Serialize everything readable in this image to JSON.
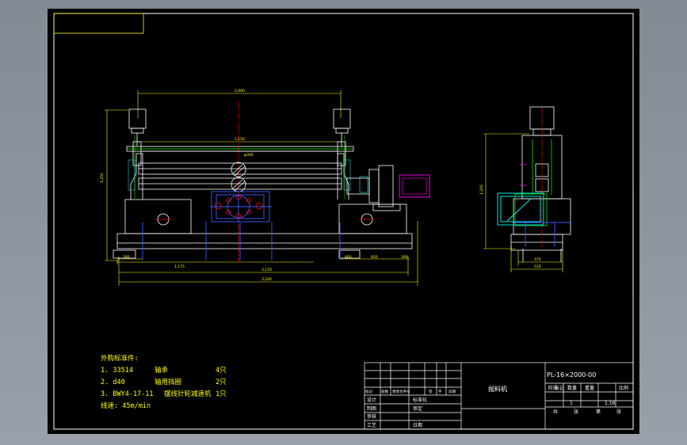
{
  "drawing": {
    "code": "PL-16×2000-00",
    "name": "抛料机",
    "scale": "1:16",
    "qty": "1"
  },
  "title_block": {
    "change_row": [
      "标记",
      "处数",
      "更改文件号",
      "签",
      "字",
      "日期"
    ],
    "design": "设计",
    "standard": "标准化",
    "drawn": "制图",
    "review": "审核",
    "approve": "审定",
    "process": "工艺",
    "date": "日期",
    "stage_row": [
      "阶段",
      "标记",
      "数量",
      "重量",
      "比例"
    ],
    "sheet_row": [
      "共",
      "张",
      "第",
      "张"
    ]
  },
  "notes": {
    "title": "外购标准件:",
    "items": [
      {
        "no": "1. 33514",
        "name": "轴承",
        "qty": "4只"
      },
      {
        "no": "2. d40",
        "name": "轴用挡圈",
        "qty": "2只"
      },
      {
        "no": "3. BWY4-17-11",
        "name": "摆线针轮减速机",
        "qty": "1只"
      }
    ],
    "speed": "线速: 45m/min"
  },
  "dims": {
    "top": "2,000",
    "mid": "1,150",
    "left_h": "1,250",
    "b1": "1,175",
    "b2": "3,110",
    "b3": "3,240",
    "b_left": "300",
    "b_r1": "460",
    "b_r2": "920",
    "b_r3": "300",
    "side_h": "1,200",
    "side_b1": "370",
    "side_b2": "510",
    "roll_dia": "φ300"
  },
  "colors": {
    "sheet": "#000000",
    "frame": "#ffffff",
    "dim": "#ffff00",
    "machine": "#ffffff",
    "center": "#ff0000",
    "blue": "#3c5cff",
    "motor": "#ff00ff",
    "green": "#00ff00",
    "cyan": "#00ffff"
  }
}
